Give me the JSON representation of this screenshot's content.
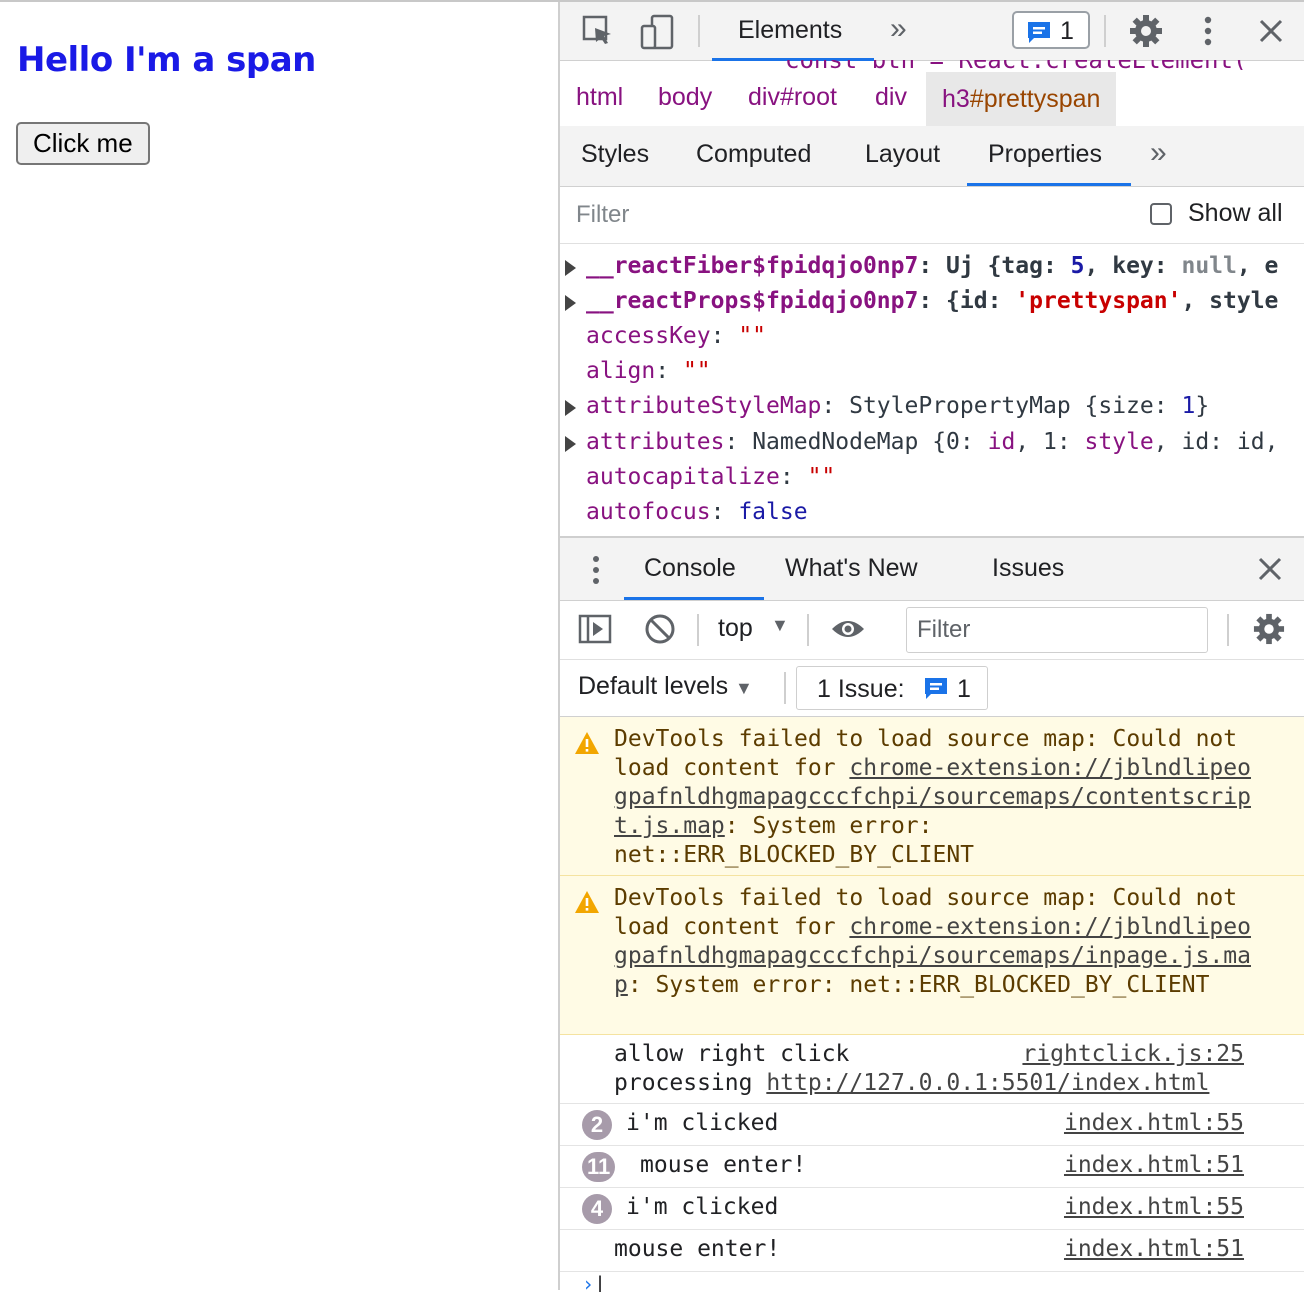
{
  "page": {
    "heading": "Hello I'm a span",
    "button_label": "Click me"
  },
  "devtools": {
    "top_tab": "Elements",
    "issues_badge_count": "1",
    "crumb_overflow_text": "const btn = React.createElement(",
    "breadcrumbs": [
      "html",
      "body",
      "div#root",
      "div"
    ],
    "breadcrumb_selected_tag": "h3",
    "breadcrumb_selected_id": "#prettyspan",
    "subtabs": [
      "Styles",
      "Computed",
      "Layout",
      "Properties"
    ],
    "active_subtab": "Properties",
    "filter_placeholder": "Filter",
    "show_all_label": "Show all",
    "properties": [
      {
        "key": "__reactFiber$fpidqjo0np7",
        "expandable": true,
        "bold": true,
        "v1": "Uj {tag: ",
        "v2": "5",
        "v3": ", key: ",
        "v4": "null",
        "v5": ", e"
      },
      {
        "key": "__reactProps$fpidqjo0np7",
        "expandable": true,
        "bold": true,
        "v1": "{id: ",
        "v2": "'prettyspan'",
        "v3": ", style",
        "v4": "",
        "v5": ""
      },
      {
        "key": "accessKey",
        "expandable": false,
        "bold": false,
        "v1": "",
        "v2": "\"\"",
        "v3": "",
        "v4": "",
        "v5": ""
      },
      {
        "key": "align",
        "expandable": false,
        "bold": false,
        "v1": "",
        "v2": "\"\"",
        "v3": "",
        "v4": "",
        "v5": ""
      },
      {
        "key": "attributeStyleMap",
        "expandable": true,
        "bold": false,
        "v1": "StylePropertyMap {size: ",
        "v2": "1",
        "v3": "}",
        "v4": "",
        "v5": ""
      },
      {
        "key": "attributes",
        "expandable": true,
        "bold": false,
        "v1": "NamedNodeMap {0: ",
        "v2": "id",
        "v3": ", 1: ",
        "v4": "style",
        "v5": ", id: id,"
      },
      {
        "key": "autocapitalize",
        "expandable": false,
        "bold": false,
        "v1": "",
        "v2": "\"\"",
        "v3": "",
        "v4": "",
        "v5": ""
      },
      {
        "key": "autofocus",
        "expandable": false,
        "bold": false,
        "v1": "",
        "v2": "false",
        "v3": "",
        "v4": "",
        "v5": ""
      }
    ],
    "drawer_tabs": [
      "Console",
      "What's New",
      "Issues"
    ],
    "context": "top",
    "console_filter_placeholder": "Filter",
    "default_levels": "Default levels",
    "issue_label": "1 Issue:",
    "issue_count": "1",
    "warnings": [
      {
        "pre": "DevTools failed to load source map: Could not load content for ",
        "link": "chrome-extension://jblndlipeogpafnldhgmapagcccfchpi/sourcemaps/contentscript.js.map",
        "post": ": System error: net::ERR_BLOCKED_BY_CLIENT"
      },
      {
        "pre": "DevTools failed to load source map: Could not load content for ",
        "link": "chrome-extension://jblndlipeogpafnldhgmapagcccfchpi/sourcemaps/inpage.js.map",
        "post": ": System error: net::ERR_BLOCKED_BY_CLIENT"
      }
    ],
    "allow_log": {
      "line1": "allow right click",
      "source": "rightclick.js:25",
      "line2_prefix": "processing ",
      "line2_link": "http://127.0.0.1:5501/index.html"
    },
    "logs": [
      {
        "count": "2",
        "message": "i'm clicked",
        "source": "index.html:55"
      },
      {
        "count": "11",
        "message": "mouse enter!",
        "source": "index.html:51"
      },
      {
        "count": "4",
        "message": "i'm clicked",
        "source": "index.html:55"
      },
      {
        "count": "",
        "message": "mouse enter!",
        "source": "index.html:51"
      }
    ],
    "colors": {
      "accent": "#1a73e8",
      "heading": "#1a1ae6",
      "warning_bg": "#fffbe5",
      "tag": "#881280"
    }
  }
}
